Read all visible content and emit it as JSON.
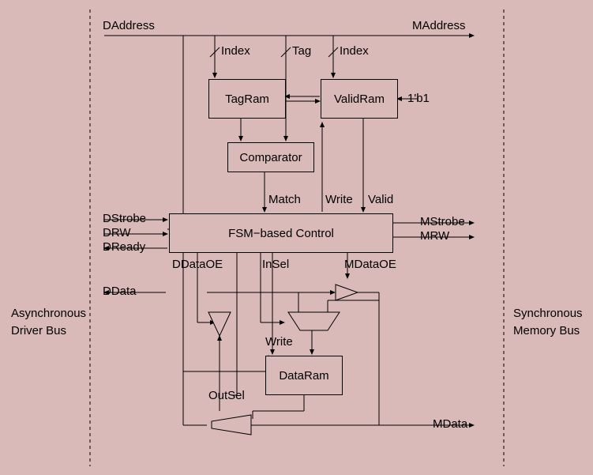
{
  "title_left_1": "Asynchronous",
  "title_left_2": "Driver Bus",
  "title_right_1": "Synchronous",
  "title_right_2": "Memory Bus",
  "top": {
    "daddress": "DAddress",
    "maddress": "MAddress",
    "index1": "Index",
    "tag": "Tag",
    "index2": "Index",
    "oneb1": "1'b1"
  },
  "blocks": {
    "tagram": "TagRam",
    "validram": "ValidRam",
    "comparator": "Comparator",
    "fsm": "FSM−based Control",
    "dataram": "DataRam"
  },
  "sig": {
    "match": "Match",
    "write": "Write",
    "valid": "Valid",
    "dstrobe": "DStrobe",
    "drw": "DRW",
    "dready": "DReady",
    "mstrobe": "MStrobe",
    "mrw": "MRW",
    "ddataoe": "DDataOE",
    "insel": "InSel",
    "mdataoe": "MDataOE",
    "ddata": "DData",
    "write2": "Write",
    "outsel": "OutSel",
    "mdata": "MData"
  }
}
